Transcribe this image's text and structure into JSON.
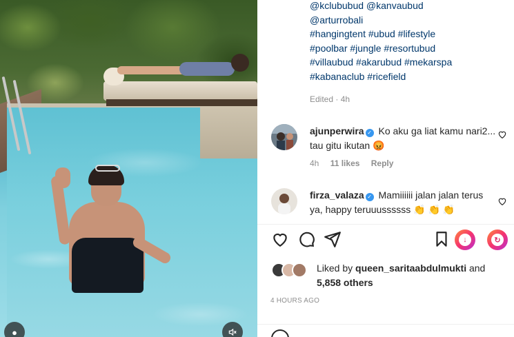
{
  "caption": {
    "lines": [
      "@kclububud @kanvaubud",
      "@arturrobali",
      "#hangingtent #ubud #lifestyle",
      "#poolbar #jungle #resortubud",
      "#villaubud #akarubud #mekarspa",
      "#kabanaclub #ricefield"
    ],
    "edited": "Edited · 4h"
  },
  "comments": [
    {
      "username": "ajunperwira",
      "text": "Ko aku ga liat kamu nari2... tau gitu ikutan 😡",
      "time": "4h",
      "likes": "11 likes",
      "reply": "Reply"
    },
    {
      "username": "firza_valaza",
      "text": "Mamiiiiii jalan jalan terus ya, happy teruuussssss 👏 👏 👏"
    }
  ],
  "actions": {
    "like_icon": "heart-icon",
    "comment_icon": "comment-icon",
    "share_icon": "send-icon",
    "save_icon": "bookmark-icon"
  },
  "likes": {
    "prefix": "Liked by ",
    "user": "queen_saritaabdulmukti",
    "connector": " and",
    "others": "5,858 others"
  },
  "timestamp": "4 HOURS AGO",
  "colors": {
    "link": "#00376b",
    "verified": "#3797f0",
    "muted": "#8e8e8e",
    "text": "#262626"
  }
}
